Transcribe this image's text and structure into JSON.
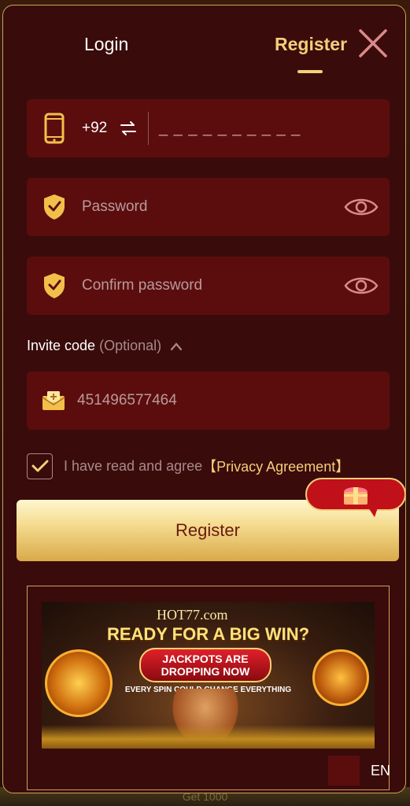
{
  "tabs": {
    "login": "Login",
    "register": "Register",
    "active": "register"
  },
  "close": {
    "icon": "close-icon"
  },
  "phone": {
    "icon": "phone-icon",
    "country_code": "+92",
    "swap_icon": "swap-icon",
    "value": "_ _ _ _ _ _ _ _ _ _"
  },
  "password": {
    "icon": "shield-check-icon",
    "placeholder": "Password",
    "toggle_icon": "eye-icon"
  },
  "confirm_password": {
    "icon": "shield-check-icon",
    "placeholder": "Confirm password",
    "toggle_icon": "eye-icon"
  },
  "invite": {
    "label": "Invite code",
    "optional": "(Optional)",
    "toggle_icon": "chevron-up-icon",
    "icon": "envelope-plus-icon",
    "value": "451496577464"
  },
  "agreement": {
    "checked": true,
    "text": "I have read and agree",
    "link": "【Privacy Agreement】"
  },
  "register_button": {
    "label": "Register"
  },
  "gift_badge": {
    "icon": "gift-chest-icon"
  },
  "banner": {
    "logo": "HOT77.com",
    "headline": "READY FOR A BIG WIN?",
    "pill_line1": "JACKPOTS ARE",
    "pill_line2": "DROPPING NOW",
    "tagline": "EVERY SPIN COULD CHANGE EVERYTHING"
  },
  "language": {
    "label": "EN"
  },
  "background_bottom": {
    "text": "Get 1000"
  },
  "colors": {
    "accent_gold": "#f2cf7a",
    "panel_bg": "#3a0b0b",
    "field_bg": "#5b0d0e",
    "gift_red": "#c0101a"
  }
}
